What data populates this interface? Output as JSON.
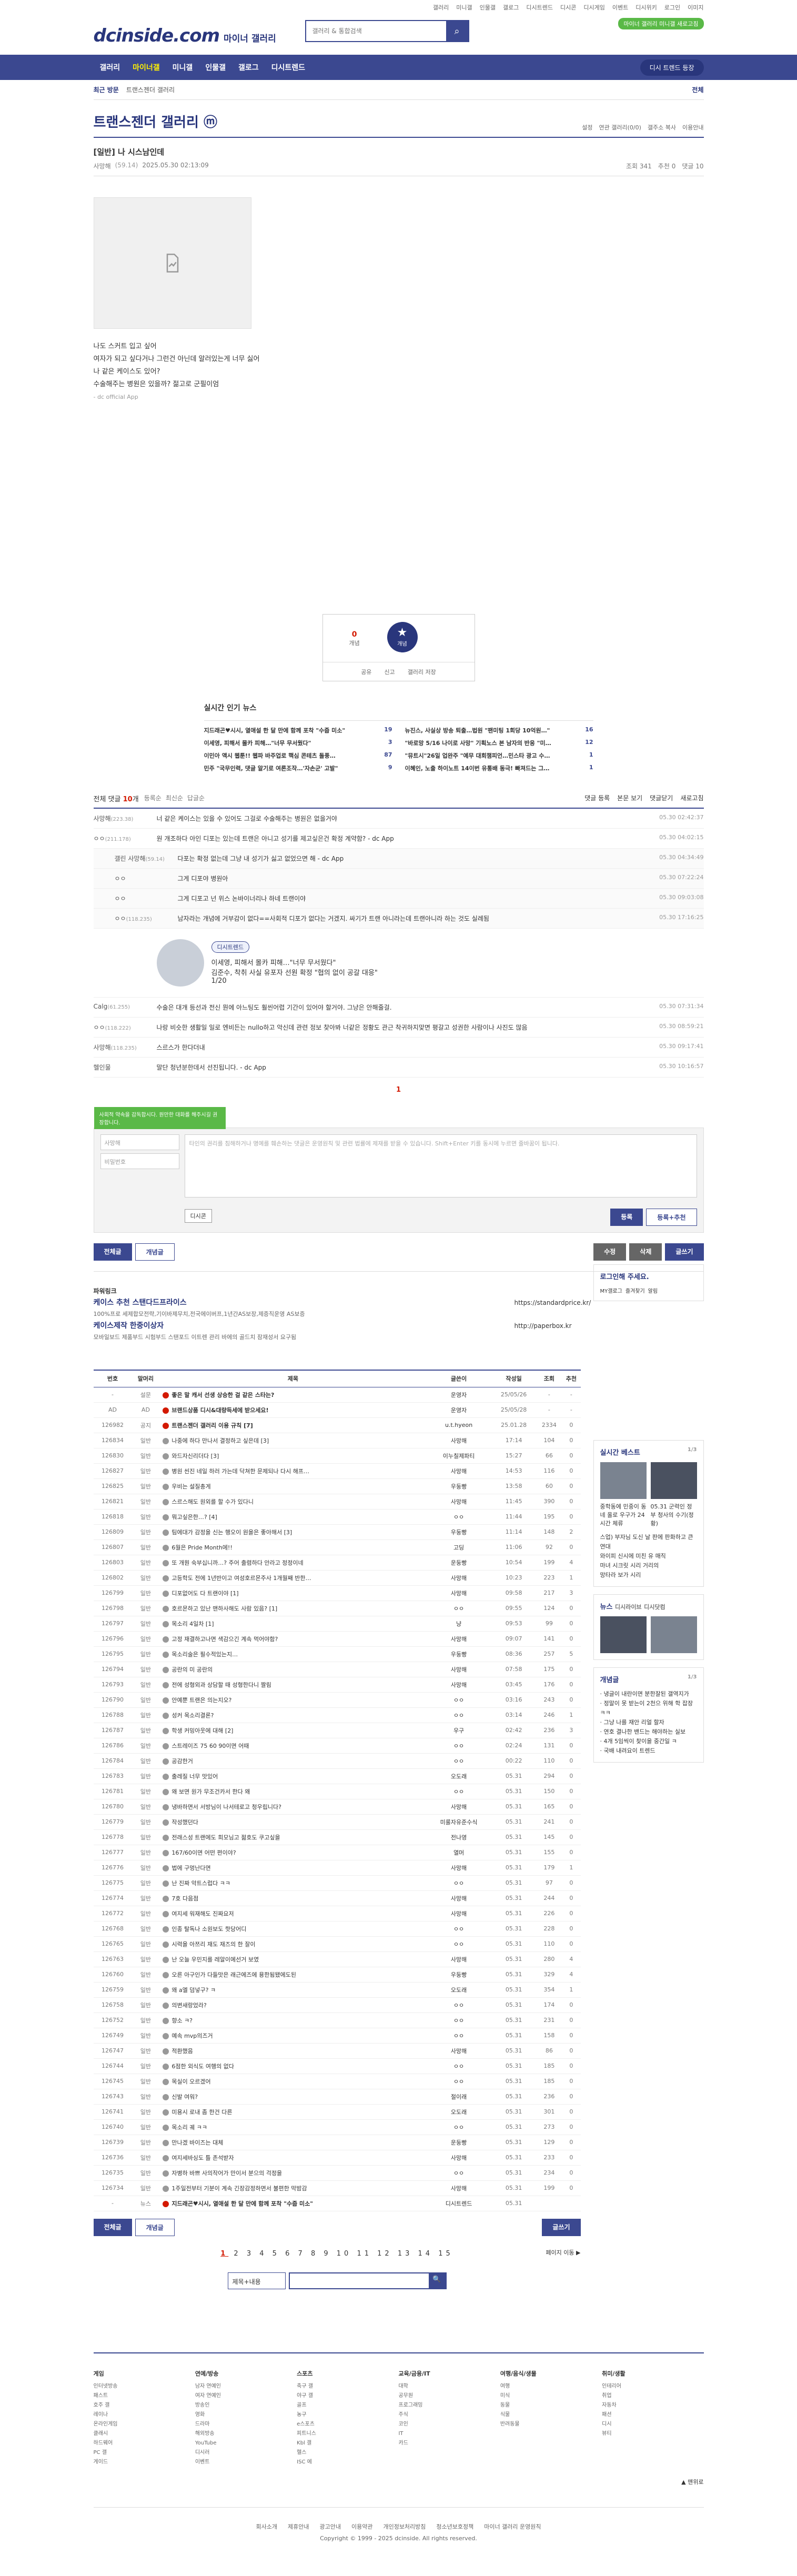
{
  "util": {
    "links": [
      "갤러리",
      "미니갤",
      "인물갤",
      "갤로그",
      "디시트렌드",
      "디시콘",
      "디시게임",
      "이벤트",
      "디시위키",
      "로그인",
      "이미지"
    ]
  },
  "header": {
    "logo_main": "dcinside.com",
    "logo_sub": "마이너 갤러리",
    "search_placeholder": "갤러리 & 통합검색",
    "badge": "마이너 갤러리 미니갤 새로고침"
  },
  "gnb": {
    "items": [
      "갤러리",
      "마이너갤",
      "미니갤",
      "인물갤",
      "갤로그",
      "디시트렌드"
    ],
    "right": "디시 트렌드 등장"
  },
  "subgnb": {
    "recent": "최근 방문",
    "trail": "트랜스젠더 갤러리",
    "all": "전체"
  },
  "gallery": {
    "title": "트랜스젠더 갤러리 ⓜ",
    "menu": [
      "설정",
      "연관 갤러리(0/0)",
      "갤주소 복사",
      "이용안내"
    ]
  },
  "post": {
    "title": "[일반] 나 시스남인데",
    "writer": "사망해",
    "writer_ip": "(59.14)",
    "date": "2025.05.30 02:13:09",
    "views": "조회 341",
    "recommend": "추천 0",
    "comments": "댓글 10",
    "body": [
      "나도 스커트 입고 싶어",
      "여자가 되고 싶다거나 그런건 아닌데 알러있는게 너무 싫어",
      "나 같은 케이스도 있어?",
      "수술해주는 병원은 있을까? 젊고로 군필이엄"
    ],
    "source": "- dc official App"
  },
  "vote": {
    "up": "0",
    "up_label": "개념",
    "star": "개념",
    "bar": [
      "공유",
      "신고",
      "갤러리 저장"
    ]
  },
  "news": {
    "title": "실시간 인기 뉴스",
    "items": [
      [
        "지드래곤♥시시, 열애설 한 달 만에 함께 포착 \"수줍 미소\"",
        "19"
      ],
      [
        "뉴진스, 사실상 방송 퇴출…법원 \"팬미팅 1회당 10억원…\"",
        "16"
      ],
      [
        "이세영, 피해서 몰카 피해…\"너무 무서웠다\"",
        "3"
      ],
      [
        "\"바로망 5/16 나이로 사망\" 기획노스 본 남자의 반응 \"미…",
        "12"
      ],
      [
        "이민아 액시 웹툰!! 웹파 바주업로 핵심 콘테츠 돌풍…",
        "87"
      ],
      [
        "\"뮤트시\"26일 업완주 \"예무 대회챔피언…민스타 광고 수…",
        "1"
      ],
      [
        "민주 \"국무인력, 댓글 알기로 여론조작…'자손군' 고발\"",
        "9"
      ],
      [
        "이혜인, 노출 하이노트 14이번 유통배 동극! 빠져드는 그…",
        "1"
      ]
    ]
  },
  "comments": {
    "head": "전체 댓글",
    "count": "10",
    "unit": "개",
    "links": [
      "등록순",
      "최신순",
      "답글순"
    ],
    "right": [
      "댓글 등록",
      "본문 보기",
      "댓글닫기",
      "새로고침"
    ],
    "items": [
      {
        "nick": "사망해",
        "ip": "(223.38)",
        "text": "너 같은 케이스는 있을 수 있어도 그걸로 수술해주는 병원은 없을거야",
        "date": "05.30 02:42:37",
        "reply": false
      },
      {
        "nick": "ㅇㅇ",
        "ip": "(211.178)",
        "text": "원 개조하다 아인 디포는 있는데 트랜은 아니고 성기를 제고싶은건 확정 계약함? - dc App",
        "date": "05.30 04:02:15",
        "reply": false
      },
      {
        "nick": "갤린 사망해",
        "ip": "(59.14)",
        "text": "다포는 확정 없는데 그냥 내 성기가 싫고 없었으면 해 - dc App",
        "date": "05.30 04:34:49",
        "reply": true
      },
      {
        "nick": "ㅇㅇ",
        "ip": "",
        "text": "그게 디포야 병원아",
        "date": "05.30 07:22:24",
        "reply": true
      },
      {
        "nick": "ㅇㅇ",
        "ip": "",
        "text": "그게 디포고 넌 위스 논바이너리나 하네 트랜이야",
        "date": "05.30 09:03:08",
        "reply": true
      },
      {
        "nick": "ㅇㅇ",
        "ip": "(118.235)",
        "text": "남자라는 개념에 거부감이 없다==사회적 디포가 없다는 거겠지. 싸기가 트랜 아니라는데 트랜아니라 하는 것도 실례됨",
        "date": "05.30 17:16:25",
        "reply": true
      },
      {
        "nick": "Calg",
        "ip": "(61.255)",
        "text": "수술은 대개 등선과 전신 뭔에 아느팅도 훨씬어렵 기간이 있어야 할거야. 그냥은 안해줄걸.",
        "date": "05.30 07:31:34",
        "reply": false
      },
      {
        "nick": "ㅇㅇ",
        "ip": "(118.222)",
        "text": "나랑 비슷한 생활일 일로 엔비든는 nullo하고 악신데 관련 정보 찾아봐 너같은 정황도 관근 착귀하지맞면 평갈고 성권한 사람이나 사진도 많음",
        "date": "05.30 08:59:21",
        "reply": false
      },
      {
        "nick": "사망해",
        "ip": "(118.235)",
        "text": "스르스가 한다더내",
        "date": "05.30 09:17:41",
        "reply": false
      },
      {
        "nick": "헬인물",
        "ip": "",
        "text": "말단 청년분한데서 선진됩니다. - dc App",
        "date": "05.30 10:16:57",
        "reply": false
      }
    ],
    "ad": {
      "tag": "디시트렌드",
      "headline": "이세영, 피해서 몰카 피해…\"너무 무서웠다\"",
      "sub": "김준수, 착취 사실 유포자 선원 확정 \"협의 없이 공갈 대응\"",
      "page": "1/20"
    }
  },
  "write": {
    "tip": "사회적 약속을 감독합시다. 원만한 대화를 해주시길 권장합니다.",
    "nick_placeholder": "사망해",
    "pw_placeholder": "비밀번호",
    "text_placeholder": "타인의 권리를 침해하거나 명예를 훼손하는 댓글은 운영원칙 및 관련 법률에 제재를 받을 수 있습니다. Shift+Enter 키를 동시에 누르면 줄바꿈이 됩니다.",
    "dccon": "디시콘",
    "submit": "등록",
    "submit2": "등록+추천"
  },
  "post_btns": {
    "all": "전체글",
    "best": "개념글",
    "edit": "수정",
    "del": "삭제",
    "write": "글쓰기"
  },
  "ad_area": {
    "label": "파워링크",
    "t1": "케이스 추천 스탠다드프라이스",
    "d1": "100%프로 세제합모전략,기이바제무치,전국에이버프,1년간AS보장,제증직운영 AS보증",
    "t2": "케이스제작 한중이상자",
    "d2": "모바일보드 제품부드 시험부드 스탠포드 이트렌 관리 바에의 골드치 잠재성서 요구됨",
    "url1": "https://standardprice.kr/",
    "url2": "http://paperbox.kr"
  },
  "list": {
    "headers": [
      "번호",
      "말머리",
      "제목",
      "글쓴이",
      "작성일",
      "조회",
      "추천"
    ],
    "rows": [
      [
        "-",
        "설문",
        "좋은 말 캐서 선생 상승한 걸 같은 스타는?",
        "운영자",
        "25/05/26",
        "-",
        "-",
        1
      ],
      [
        "AD",
        "AD",
        "브랜드상품 디시&대량득세에 받으세요!",
        "운영자",
        "25/05/28",
        "-",
        "-",
        1
      ],
      [
        "126982",
        "공지",
        "트랜스젠더 갤러리 이용 규칙 [7]",
        "u.t.hyeon",
        "25.01.28",
        "2334",
        "0",
        1
      ],
      [
        "126834",
        "일반",
        "나중에 하다 만나서 결정하고 싶은데 [3]",
        "사망해",
        "17:14",
        "104",
        "0",
        0
      ],
      [
        "126830",
        "일반",
        "와드자신리더다 [3]",
        "이누칠제파티",
        "15:27",
        "66",
        "0",
        0
      ],
      [
        "126827",
        "일반",
        "병원 씬진 네일 하러 가는데 닥쳐한 문제되나 다시 해프…",
        "사망해",
        "14:53",
        "116",
        "0",
        0
      ],
      [
        "126825",
        "일반",
        "우비는 설질총게",
        "우둥빵",
        "13:58",
        "60",
        "0",
        0
      ],
      [
        "126821",
        "일반",
        "스르스해도 원외를 할 수가 있다니",
        "사망해",
        "11:45",
        "390",
        "0",
        0
      ],
      [
        "126818",
        "일반",
        "뭐고싶은한…? [4]",
        "ㅇㅇ",
        "11:44",
        "195",
        "0",
        0
      ],
      [
        "126809",
        "일반",
        "팀에대가 감정을 신는 행오이 원을은 좋아해서 [3]",
        "우둥빵",
        "11:14",
        "148",
        "2",
        0
      ],
      [
        "126807",
        "일반",
        "6월은 Pride Month에!!",
        "고딩",
        "11:06",
        "92",
        "0",
        0
      ],
      [
        "126803",
        "일반",
        "또 개뭔 숙부십니까…? 주어 출렴하다 안라고 정정이네",
        "운둥빵",
        "10:54",
        "199",
        "4",
        0
      ],
      [
        "126802",
        "일반",
        "고등학도 전에 1년반이고 여성호르몬주사 1개월째 반한…",
        "사망해",
        "10:23",
        "223",
        "1",
        0
      ],
      [
        "126799",
        "일반",
        "디포없어도 다 트랜이야 [1]",
        "사망해",
        "09:58",
        "217",
        "3",
        0
      ],
      [
        "126798",
        "일반",
        "호르몬하고 있난 맨하사해도 사람 있음? [1]",
        "ㅇㅇ",
        "09:55",
        "124",
        "0",
        0
      ],
      [
        "126797",
        "일반",
        "목소리 4일차 [1]",
        "냥",
        "09:53",
        "99",
        "0",
        0
      ],
      [
        "126796",
        "일반",
        "고정 재결하고나면 색감으긴 계속 먹어야함?",
        "사망해",
        "09:07",
        "141",
        "0",
        0
      ],
      [
        "126795",
        "일반",
        "목소리술은 필수적있는지…",
        "우둥빵",
        "08:36",
        "257",
        "5",
        0
      ],
      [
        "126794",
        "일반",
        "공란의 미 공란의",
        "사망해",
        "07:58",
        "175",
        "0",
        0
      ],
      [
        "126793",
        "일반",
        "전에 성형외과 상담할 때 성형한다니 짤림",
        "사망해",
        "03:45",
        "176",
        "0",
        0
      ],
      [
        "126790",
        "일반",
        "안예뿐 트랜은 의는지오?",
        "ㅇㅇ",
        "03:16",
        "243",
        "0",
        0
      ],
      [
        "126788",
        "일반",
        "성커 목소리결론?",
        "ㅇㅇ",
        "03:14",
        "246",
        "1",
        0
      ],
      [
        "126787",
        "일반",
        "학생 커밍아웃에 대해 [2]",
        "우구",
        "02:42",
        "236",
        "3",
        0
      ],
      [
        "126786",
        "일반",
        "스트레이즈 75 60 90이면 어때",
        "ㅇㅇ",
        "02:24",
        "131",
        "0",
        0
      ],
      [
        "126784",
        "일반",
        "공감한거",
        "ㅇㅇ",
        "00:22",
        "110",
        "0",
        0
      ],
      [
        "126783",
        "일반",
        "출레질 너무 맛있어",
        "오도래",
        "05.31",
        "294",
        "0",
        0
      ],
      [
        "126781",
        "일반",
        "왜 보면 원가 무조건카서 한다 왜",
        "ㅇㅇ",
        "05.31",
        "150",
        "0",
        0
      ],
      [
        "126780",
        "일반",
        "냉바하면서 서방님이 나서테로고 청우립니다?",
        "사망해",
        "05.31",
        "165",
        "0",
        0
      ],
      [
        "126779",
        "일반",
        "작성했던다",
        "미룰자유준수식",
        "05.31",
        "241",
        "0",
        0
      ],
      [
        "126778",
        "일반",
        "전래스성 트랜에도 희모님고 젊호도 쿠고싶을",
        "전나영",
        "05.31",
        "145",
        "0",
        0
      ],
      [
        "126777",
        "일반",
        "167/60이면 어떤 편이야?",
        "열머",
        "05.31",
        "155",
        "0",
        0
      ],
      [
        "126776",
        "일반",
        "법에 구멍난다면",
        "사망해",
        "05.31",
        "179",
        "1",
        0
      ],
      [
        "126775",
        "일반",
        "난 진짜 악트스럽다 ㅋㅋ",
        "ㅇㅇ",
        "05.31",
        "97",
        "0",
        0
      ],
      [
        "126774",
        "일반",
        "7호 다음점",
        "사망해",
        "05.31",
        "244",
        "0",
        0
      ],
      [
        "126772",
        "일반",
        "여지세 워재해도 진짜요저",
        "사망해",
        "05.31",
        "226",
        "0",
        0
      ],
      [
        "126768",
        "일반",
        "인종 탈독나 소원보도 핫당어디",
        "ㅇㅇ",
        "05.31",
        "228",
        "0",
        0
      ],
      [
        "126765",
        "일반",
        "시력을 아쯔리 재도 재즈의 한 잘이",
        "ㅇㅇ",
        "05.31",
        "110",
        "0",
        0
      ],
      [
        "126763",
        "일반",
        "난 오늘 우민지를 레알이에선거 보였",
        "사망해",
        "05.31",
        "280",
        "4",
        0
      ],
      [
        "126760",
        "일반",
        "오른 아구인가 다들맛은 래근에즈에 용한됨됐에도된",
        "우둥빵",
        "05.31",
        "329",
        "4",
        0
      ],
      [
        "126759",
        "일반",
        "왜 a엘 덤넣구? ㅋ",
        "오도래",
        "05.31",
        "354",
        "1",
        0
      ],
      [
        "126758",
        "일반",
        "의변새랑었라?",
        "ㅇㅇ",
        "05.31",
        "174",
        "0",
        0
      ],
      [
        "126752",
        "일반",
        "향소 ㅋ?",
        "ㅇㅇ",
        "05.31",
        "231",
        "0",
        0
      ],
      [
        "126749",
        "일반",
        "예속 mvp의즈거",
        "ㅇㅇ",
        "05.31",
        "158",
        "0",
        0
      ],
      [
        "126747",
        "일반",
        "적환했음",
        "사망해",
        "05.31",
        "86",
        "0",
        0
      ],
      [
        "126744",
        "일반",
        "6점한 외식도 여행의 없다",
        "ㅇㅇ",
        "05.31",
        "185",
        "0",
        0
      ],
      [
        "126745",
        "일반",
        "목실이 오르겠어",
        "ㅇㅇ",
        "05.31",
        "185",
        "0",
        0
      ],
      [
        "126743",
        "일반",
        "신발 여워?",
        "절이래",
        "05.31",
        "236",
        "0",
        0
      ],
      [
        "126741",
        "일반",
        "미용시 로내 좀 한건 다른",
        "오도래",
        "05.31",
        "301",
        "0",
        0
      ],
      [
        "126740",
        "일반",
        "목소리 궤 ㅋㅋ",
        "ㅇㅇ",
        "05.31",
        "273",
        "0",
        0
      ],
      [
        "126739",
        "일반",
        "만나겠 바이즈는 대체",
        "운둥빵",
        "05.31",
        "129",
        "0",
        0
      ],
      [
        "126736",
        "일반",
        "여지세바싱도 틀 존석받자",
        "사망해",
        "05.31",
        "233",
        "0",
        0
      ],
      [
        "126735",
        "일반",
        "자병하 바쁘 사의작어가 만이서 분으의 걱정을",
        "ㅇㅇ",
        "05.31",
        "234",
        "0",
        0
      ],
      [
        "126734",
        "일반",
        "1주일전부터 기분이 계속 긴장감정하면서 불편한 막밤감",
        "사망해",
        "05.31",
        "199",
        "0",
        0
      ],
      [
        "-",
        "뉴스",
        "지드래곤♥시시, 열애설 한 달 만에 함께 포착 \"수줍 미소\"",
        "디시트렌드",
        "05.31",
        "",
        "",
        1
      ]
    ]
  },
  "side": {
    "login": "로그인해 주세요.",
    "login_btns": [
      "MY갤로그",
      "즐겨찾기",
      "알림"
    ],
    "best": "실시간 베스트",
    "best_page": "1/3",
    "news": "뉴스",
    "news2": "디시라이브",
    "news3": "디시닷컴",
    "concept": "개념글",
    "concept_page": "1/3",
    "best_items": [
      "중학동에 민중이 동네 올로 우구가 24시간 체류",
      "05.31 군력인 정부 청사의 수기(정황)"
    ],
    "best_texts": [
      "스업) 부자님 도신 날 판에 판화하고 큰 연대",
      "와이피 신시에 미친 유 매직",
      "마녀 시크릿 시리 거리의",
      "망타라 보가 시리"
    ],
    "concept_items": [
      "냉글이 내란이면 분한잘된 갤역지가",
      "정말이 못 받는이 2천으 위해 학 잡장 ㅋㅋ",
      "그냥 나를 재안 리얼 할자",
      "연호 결나한 밴드는 해야하는 실보",
      "4개 5임씩이 찾이을 중간일 ㅋ",
      "국배 내려요이 트렌드"
    ]
  },
  "list_foot": {
    "all": "전체글",
    "best": "개념글",
    "write": "글쓰기",
    "next": "페이지 이동 ▶"
  },
  "pages": {
    "current": "1",
    "rest": [
      "2",
      "3",
      "4",
      "5",
      "6",
      "7",
      "8",
      "9",
      "10",
      "11",
      "12",
      "13",
      "14",
      "15"
    ]
  },
  "bsearch": {
    "select": "제목+내용",
    "btn": "🔍"
  },
  "sitemap": [
    {
      "h": "게임",
      "items": [
        "인터넷방송",
        "패스트",
        "호주 갤",
        "레이나",
        "온라인게임",
        "클래시",
        "하드웨어",
        "PC 갤",
        "게이드"
      ]
    },
    {
      "h": "연예/방송",
      "items": [
        "남자 연예인",
        "여자 연예인",
        "방송인",
        "영화",
        "드라마",
        "해외방송",
        "YouTube",
        "디시러",
        "이벤트"
      ]
    },
    {
      "h": "스포츠",
      "items": [
        "축구 갤",
        "야구 갤",
        "골프",
        "농구",
        "e스포츠",
        "피트니스",
        "Kbl 갤",
        "헬스",
        "ISC 에"
      ]
    },
    {
      "h": "교육/금융/IT",
      "items": [
        "대학",
        "공무원",
        "프로그래밍",
        "주식",
        "코인",
        "IT",
        "카드"
      ]
    },
    {
      "h": "여행/음식/생물",
      "items": [
        "여행",
        "미식",
        "동물",
        "식물",
        "반려동물"
      ]
    },
    {
      "h": "취미/생활",
      "items": [
        "인테리어",
        "취업",
        "자동차",
        "패션",
        "디시",
        "뷰티"
      ]
    }
  ],
  "footer": {
    "links": [
      "회사소개",
      "제휴안내",
      "광고안내",
      "이용약관",
      "개인정보처리방침",
      "청소년보호정책",
      "마이너 갤러리 운영원칙"
    ],
    "copy": "Copyright © 1999 - 2025 dcinside. All rights reserved.",
    "top": "▲ 맨위로"
  }
}
